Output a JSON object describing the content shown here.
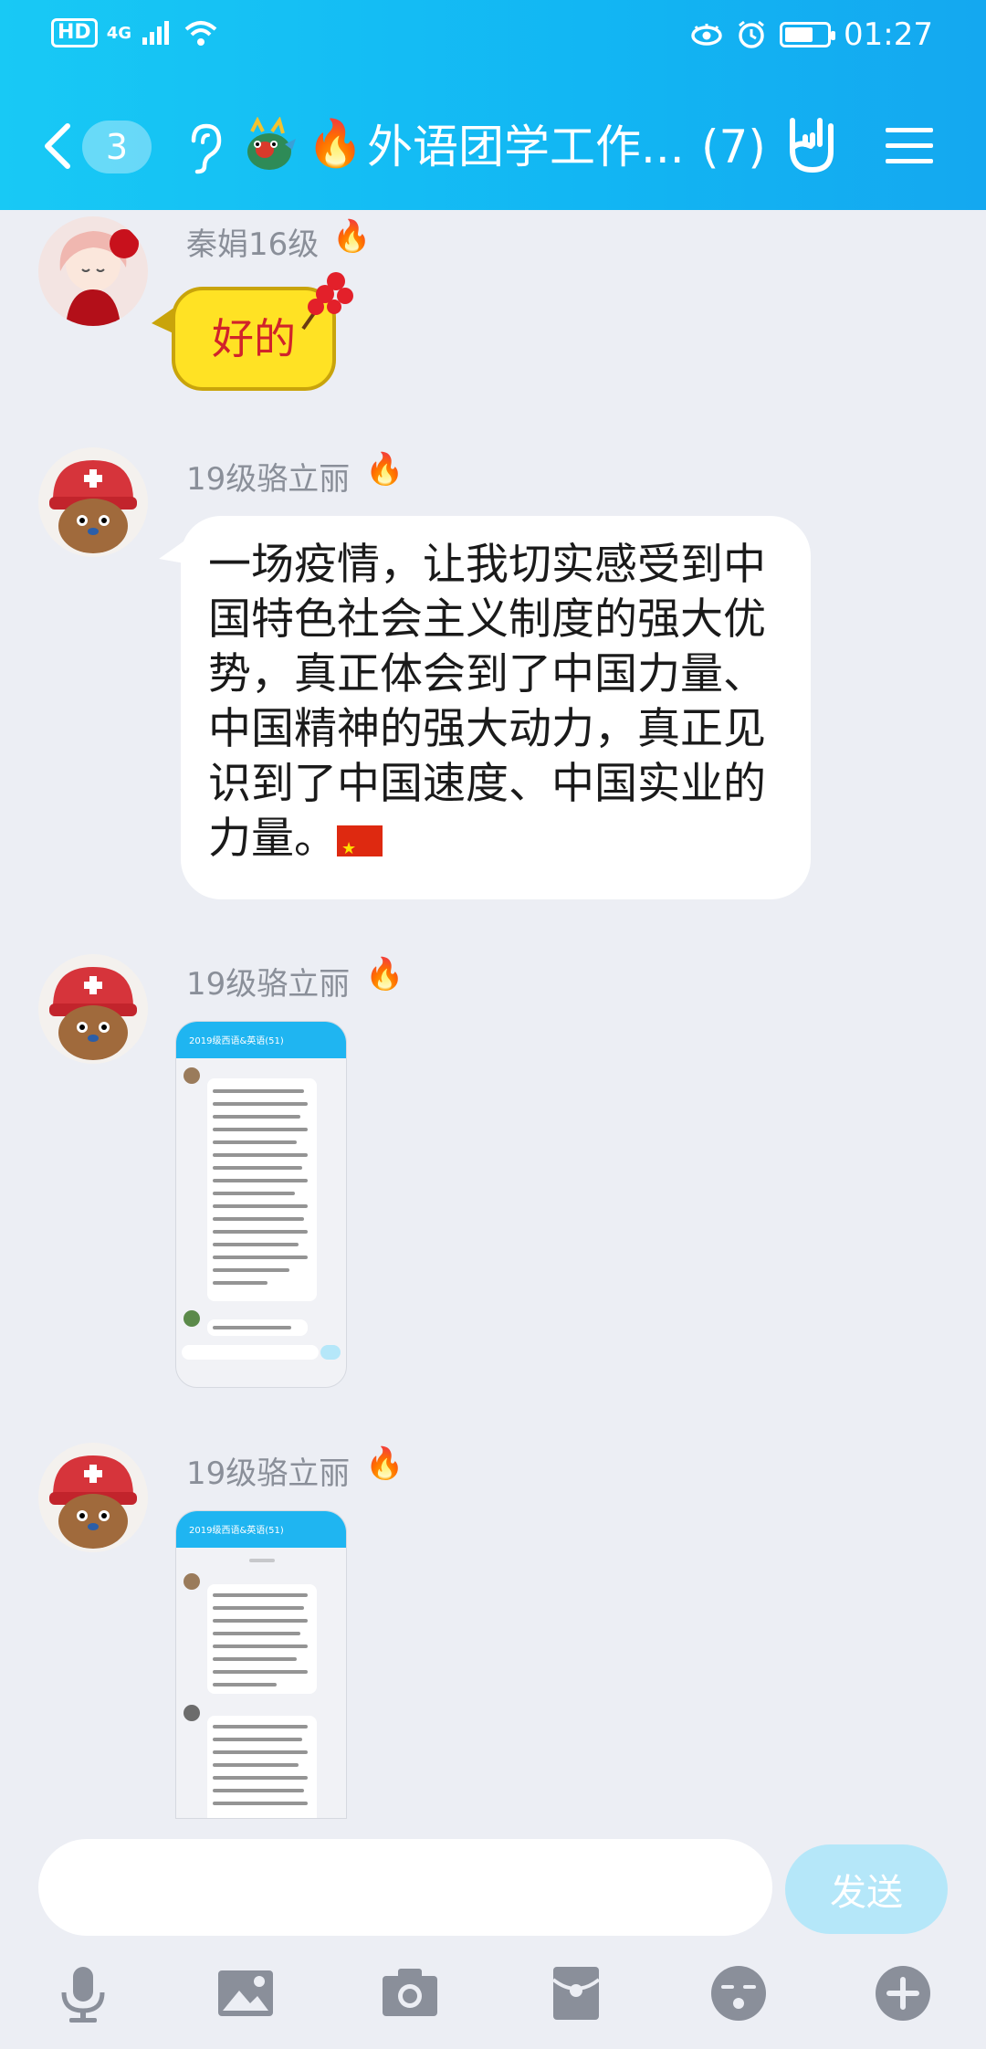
{
  "status_bar": {
    "hd_badge": "HD",
    "network": "4G",
    "time": "01:27",
    "battery_level": 0.6
  },
  "header": {
    "unread_count": "3",
    "group_title": "外语团学工作...",
    "member_count": "(7)"
  },
  "messages": [
    {
      "sender": "秦娟16级",
      "type": "sticker-text",
      "text": "好的"
    },
    {
      "sender": "19级骆立丽",
      "type": "text",
      "text": "一场疫情，让我切实感受到中国特色社会主义制度的强大优势，真正体会到了中国力量、中国精神的强大动力，真正见识到了中国速度、中国实业的力量。"
    },
    {
      "sender": "19级骆立丽",
      "type": "image",
      "thumb_title": "2019级西语&英语(51)"
    },
    {
      "sender": "19级骆立丽",
      "type": "image",
      "thumb_title": "2019级西语&英语(51)"
    }
  ],
  "input": {
    "value": "",
    "send_label": "发送"
  },
  "toolbar": [
    "microphone-icon",
    "image-icon",
    "camera-icon",
    "red-packet-icon",
    "emoji-icon",
    "plus-icon"
  ],
  "colors": {
    "header_gradient_start": "#18c9f5",
    "header_gradient_end": "#14a8f0",
    "background": "#eceef4",
    "send_button": "#b5e7f9"
  }
}
